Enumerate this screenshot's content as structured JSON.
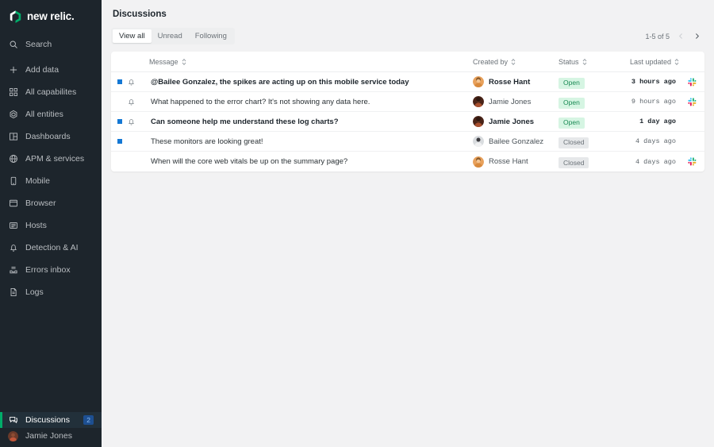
{
  "brand": {
    "name": "new relic.",
    "logo_icon": "new-relic-cube-icon",
    "accent_green": "#00ac69"
  },
  "sidebar": {
    "top_items": [
      {
        "label": "Search",
        "icon": "search-icon"
      },
      {
        "label": "Add data",
        "icon": "plus-icon"
      }
    ],
    "nav_items": [
      {
        "label": "All capabilites",
        "icon": "grid-icon"
      },
      {
        "label": "All entities",
        "icon": "hexagon-icon"
      },
      {
        "label": "Dashboards",
        "icon": "dashboard-icon"
      },
      {
        "label": "APM & services",
        "icon": "globe-icon"
      },
      {
        "label": "Mobile",
        "icon": "phone-icon"
      },
      {
        "label": "Browser",
        "icon": "window-icon"
      },
      {
        "label": "Hosts",
        "icon": "server-icon"
      },
      {
        "label": "Detection & AI",
        "icon": "bell-icon"
      },
      {
        "label": "Errors inbox",
        "icon": "inbox-icon"
      },
      {
        "label": "Logs",
        "icon": "document-icon"
      }
    ],
    "bottom_items": [
      {
        "label": "Discussions",
        "icon": "chat-icon",
        "badge": "2",
        "active": true
      },
      {
        "label": "Jamie Jones",
        "icon": "user-avatar",
        "badge": "",
        "active": false
      }
    ]
  },
  "header": {
    "title": "Discussions"
  },
  "tabs": [
    {
      "label": "View all",
      "active": true
    },
    {
      "label": "Unread",
      "active": false
    },
    {
      "label": "Following",
      "active": false
    }
  ],
  "pagination": {
    "range_label": "1-5 of 5",
    "prev_icon": "chevron-left-icon",
    "next_icon": "chevron-right-icon"
  },
  "table": {
    "columns": [
      {
        "key": "message",
        "label": "Message",
        "sortable": true
      },
      {
        "key": "created_by",
        "label": "Created by",
        "sortable": true
      },
      {
        "key": "status",
        "label": "Status",
        "sortable": true
      },
      {
        "key": "last_updated",
        "label": "Last updated",
        "sortable": true
      }
    ],
    "rows": [
      {
        "unread_dot": true,
        "bell": true,
        "unread": true,
        "message": "@Bailee Gonzalez, the spikes are acting up on this mobile service today",
        "created_by": "Rosse Hant",
        "avatar": "rosse",
        "status": "Open",
        "status_kind": "open",
        "last_updated": "3 hours ago",
        "slack": true
      },
      {
        "unread_dot": false,
        "bell": true,
        "unread": false,
        "message": "What happened to the error chart? It's not showing any data here.",
        "created_by": "Jamie Jones",
        "avatar": "jamie",
        "status": "Open",
        "status_kind": "open",
        "last_updated": "9 hours ago",
        "slack": true
      },
      {
        "unread_dot": true,
        "bell": true,
        "unread": true,
        "message": "Can someone help me understand these log charts?",
        "created_by": "Jamie Jones",
        "avatar": "jamie",
        "status": "Open",
        "status_kind": "open",
        "last_updated": "1 day ago",
        "slack": false
      },
      {
        "unread_dot": true,
        "bell": false,
        "unread": false,
        "message": "These monitors are looking great!",
        "created_by": "Bailee Gonzalez",
        "avatar": "bailee",
        "status": "Closed",
        "status_kind": "closed",
        "last_updated": "4 days ago",
        "slack": false
      },
      {
        "unread_dot": false,
        "bell": false,
        "unread": false,
        "message": "When will the core web vitals be up on the summary page?",
        "created_by": "Rosse Hant",
        "avatar": "rosse",
        "status": "Closed",
        "status_kind": "closed",
        "last_updated": "4 days ago",
        "slack": true
      }
    ]
  }
}
